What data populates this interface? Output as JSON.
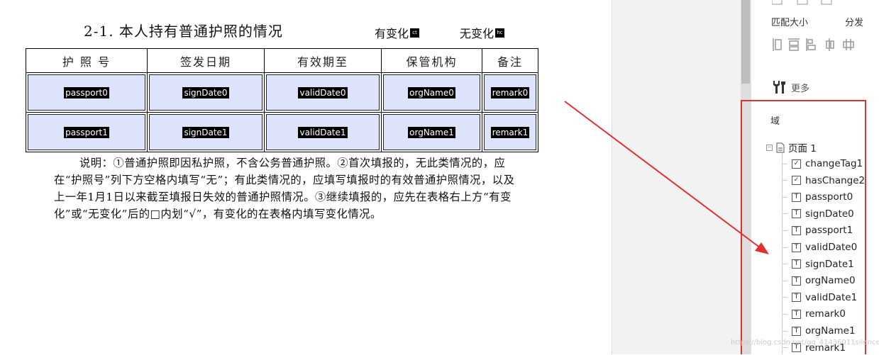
{
  "document": {
    "title": "2-1. 本人持有普通护照的情况",
    "change_label": "有变化",
    "change_box": "ct",
    "nochange_label": "无变化",
    "nochange_box": "hc",
    "headers": [
      "护 照 号",
      "签发日期",
      "有效期至",
      "保管机构",
      "备注"
    ],
    "rows": [
      [
        "passport0",
        "signDate0",
        "validDate0",
        "orgName0",
        "remark0"
      ],
      [
        "passport1",
        "signDate1",
        "validDate1",
        "orgName1",
        "remark1"
      ]
    ],
    "note": "说明：①普通护照即因私护照，不含公务普通护照。②首次填报的，无此类情况的，应在“护照号”列下方空格内填写“无”；有此类情况的，应填写填报时的有效普通护照情况，以及上一年1月1日以来截至填报日失效的普通护照情况。③继续填报的，应先在表格右上方“有变化”或“无变化”后的□内划“√”，有变化的在表格内填写变化情况。"
  },
  "toolbar": {
    "match_size": "匹配大小",
    "distribute": "分发",
    "more": "更多"
  },
  "fields_panel": {
    "title": "域",
    "root": "页面 1",
    "items": [
      {
        "label": "changeTag1",
        "icon": "checkbox-icon"
      },
      {
        "label": "hasChange2",
        "icon": "checkbox-icon"
      },
      {
        "label": "passport0",
        "icon": "text-field-icon"
      },
      {
        "label": "signDate0",
        "icon": "text-field-icon"
      },
      {
        "label": "passport1",
        "icon": "text-field-icon"
      },
      {
        "label": "validDate0",
        "icon": "text-field-icon"
      },
      {
        "label": "signDate1",
        "icon": "text-field-icon"
      },
      {
        "label": "orgName0",
        "icon": "text-field-icon"
      },
      {
        "label": "validDate1",
        "icon": "text-field-icon"
      },
      {
        "label": "remark0",
        "icon": "text-field-icon"
      },
      {
        "label": "orgName1",
        "icon": "text-field-icon"
      },
      {
        "label": "remark1",
        "icon": "text-field-icon"
      }
    ]
  },
  "watermark": "https://blog.csdn.net/qq_41436011silence",
  "colors": {
    "field_bg": "#dde3fb",
    "highlight": "#e03030"
  }
}
